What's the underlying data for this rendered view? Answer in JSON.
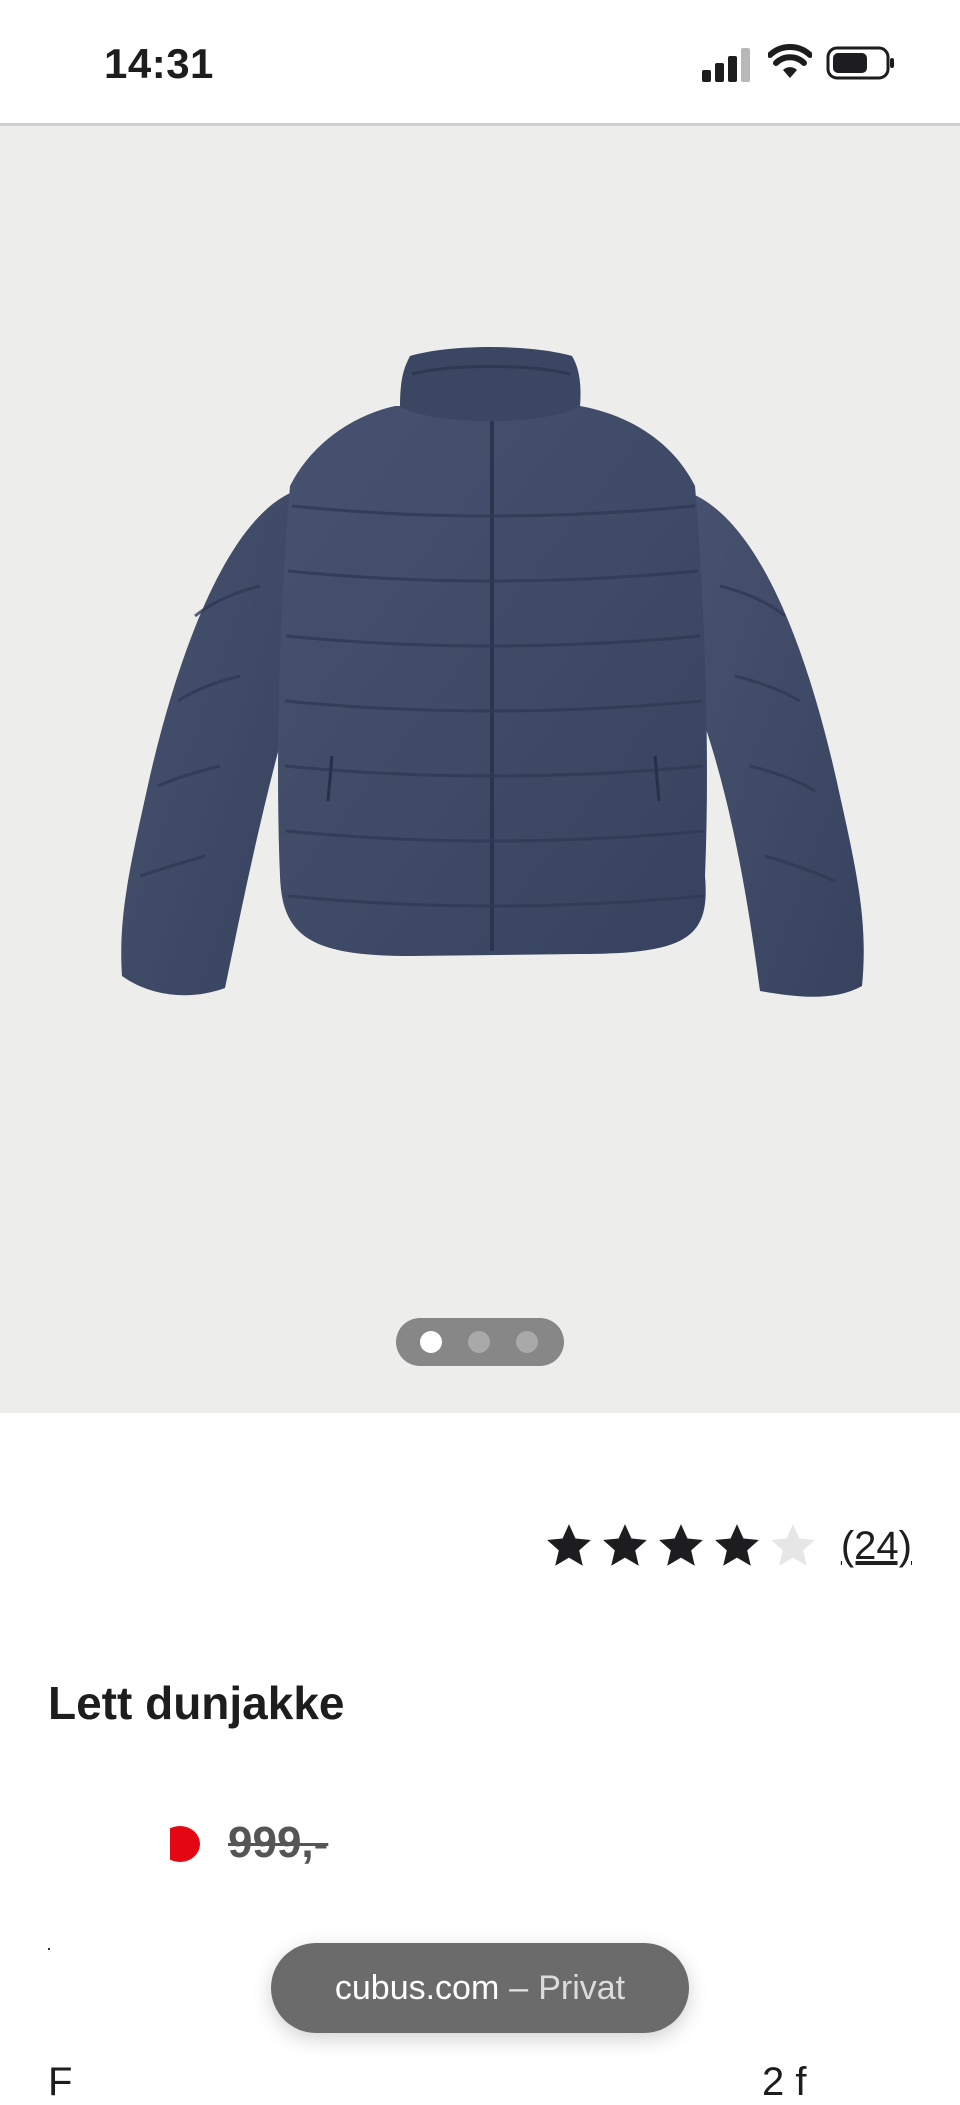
{
  "status_bar": {
    "time": "14:31",
    "icons": [
      "signal-icon",
      "wifi-icon",
      "battery-icon"
    ]
  },
  "gallery": {
    "image": "navy-quilted-down-jacket",
    "pager": {
      "count": 3,
      "active_index": 0
    }
  },
  "rating": {
    "stars": 4,
    "max_stars": 5,
    "review_count": "(24)"
  },
  "product": {
    "title": "Lett dunjakke",
    "old_price": "999,-"
  },
  "browser": {
    "domain": "cubus.com",
    "separator": "–",
    "mode": "Privat"
  },
  "peek": {
    "left": "F",
    "right": "2 f"
  },
  "colors": {
    "hero_bg": "#ededeb",
    "jacket": "#3f4c69",
    "star": "#1d1d1f",
    "star_empty": "#e6e6e6",
    "sale_red": "#e30613",
    "url_pill": "#6b6b6b"
  }
}
